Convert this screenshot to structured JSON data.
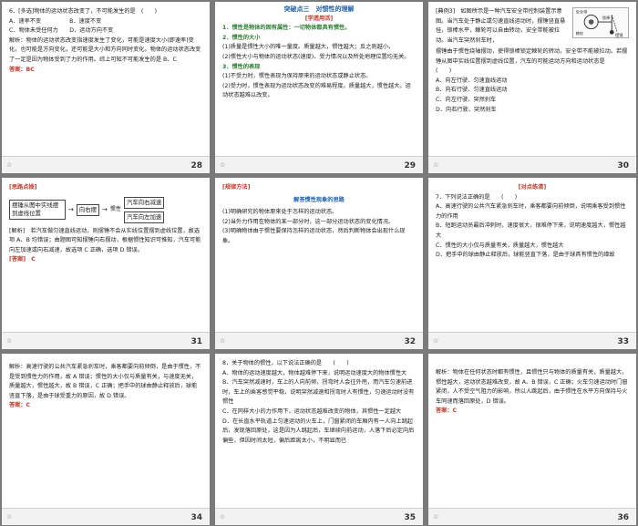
{
  "slides": [
    {
      "page": "28",
      "lines": [
        "6．[多选]物体的运动状态改变了，不可能发生的是　(　　)",
        "A．速率不变　　　　　B．速度不变",
        "C．物体未受任何力　　D．运动方向不变",
        "解析：物体的运动状态改变指速度发生了变化，可能是速度大小(即速率)变化，也可能是方向变化，还可能是大小和方向同时变化。物体的运动状态改变了一定是因为物体受到了力的作用。综上可知不可能发生的是 B、C",
        "答案：BC"
      ]
    },
    {
      "page": "29",
      "title": "突破点三　对惯性的理解",
      "tag": "[学透用活]",
      "lines": [
        "1．惯性是物体的固有属性：一切物体都具有惯性。",
        "2．惯性的大小",
        "(1)质量是惯性大小的唯一量度。质量越大，惯性越大；反之则越小。",
        "(2)惯性大小与物体的运动状态(速度)、受力情况以及所处地理位置均无关。",
        "3．惯性的表现",
        "(1)不受力时，惯性表现为保持原来的运动状态或静止状态。",
        "(2)受力时，惯性表现为运动状态改变的难易程度。质量越大，惯性越大，运动状态越难以改变。"
      ]
    },
    {
      "page": "30",
      "lines_top": [
        "[典例3]　如图所示是一种汽车安全带控制装置示意图。当汽车处于静止或匀速直线运动时，摆锤竖直悬挂，锁棒水平，棘轮可以自由转动，安全带能被拉动。当汽车突然刹车时，"
      ],
      "lines": [
        "摆锤由于惯性绕轴摆动，使得锁棒锁定棘轮的转动，安全带不能被拉动。若摆锤从图中实线位置摆到虚线位置，汽车的可能运动方向和运动状态是　　　(　　)",
        "A．向左行驶、匀速直线运动",
        "B．向右行驶、匀速直线运动",
        "C．向左行驶、突然刹车",
        "D．向右行驶、突然刹车"
      ],
      "fig_labels": [
        "安全带",
        "棘轮",
        "锁棒",
        "摆锤"
      ]
    },
    {
      "page": "31",
      "tag": "[思路点拨]",
      "diagram": {
        "box1": "摆锤从图中实线摆到虚线位置",
        "box2": "向右摆",
        "mid": "惯性",
        "out1": "汽车向右减速",
        "out2": "汽车向左加速"
      },
      "lines": [
        "[解析]　若汽车做匀速直线运动，则摆锤不会从实线位置摆到虚线位置，故选项 A、B 均错误；由题图可知摆锤向右摆动，根据惯性知识可推知，汽车可能向左加速或向右减速，故选项 C 正确，选项 D 错误。",
        "[答案]　C"
      ]
    },
    {
      "page": "32",
      "tag": "[规律方法]",
      "title": "解答惯性现象的思路",
      "lines": [
        "(1)明确研究的物体原来处于怎样的运动状态。",
        "(2)当外力作用在物体的某一部分时，这一部分运动状态的变化情况。",
        "(3)明确物体由于惯性要保持怎样的运动状态，然后判断物体会出现什么现象。"
      ]
    },
    {
      "page": "33",
      "tag": "[对点练清]",
      "lines": [
        "7．下列说法正确的是　　(　　)",
        "A．高速行驶的公共汽车紧急刹车时，乘客都要向前倾倒，说明乘客受到惯性力的作用",
        "B．短跑运动员最后冲刺时，速度很大，很难停下来，说明速度越大，惯性越大",
        "C．惯性的大小仅与质量有关，质量越大，惯性越大",
        "D．把手中的球由静止释放后，球能竖直下落，是由于球具有惯性的缘故"
      ]
    },
    {
      "page": "34",
      "lines": [
        "解析：高速行驶的公共汽车紧急刹车时，乘客都要向前倾倒，是由于惯性，不是受到惯性力的作用，故 A 错误；惯性的大小仅与质量有关，与速度无关，质量越大，惯性越大，故 B 错误，C 正确；把手中的球由静止释放后，球能竖直下落，是由于球受重力的原因，故 D 错误。",
        "答案：C"
      ]
    },
    {
      "page": "35",
      "lines": [
        "8．关于物体的惯性，以下说法正确的是　　(　　)",
        "A．物体的运动速度越大，物体越难停下来，说明运动速度大的物体惯性大",
        "B．汽车突然减速时，车上的人向前倾，拐弯时人会往外甩，而汽车匀速前进时，车上的乘客感觉平稳，说明突然减速和拐弯时人有惯性，匀速运动时没有惯性",
        "C．在同样大小的力作用下，运动状态越难改变的物体，其惯性一定越大",
        "D．在长直水平轨道上匀速运动的火车上，门窗紧闭的车厢内有一人向上跳起后，发现落回原处，这是因为人跳起后，车继续向前运动，人落下后必定向后偏些，但因时间太短，偏后距离太小，不明显而已"
      ]
    },
    {
      "page": "36",
      "lines": [
        "解析：物体在任何状态时都有惯性，且惯性只与物体的质量有关，质量越大，惯性越大，运动状态越难改变，故 A、B 错误，C 正确；火车匀速运动时门窗紧闭，人不受空气阻力的影响，所以人跳起后，由于惯性在水平方向保持与火车同速而落回原处，D 错误。",
        "答案：C"
      ]
    }
  ]
}
